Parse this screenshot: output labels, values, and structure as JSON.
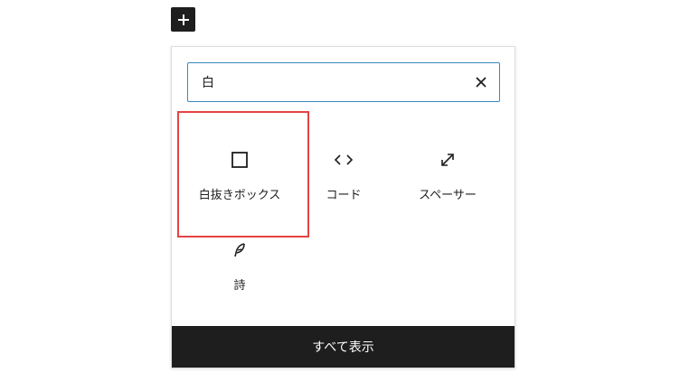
{
  "toolbar": {
    "add_block_icon": "plus-icon"
  },
  "search": {
    "value": "白",
    "clear_icon": "close-icon"
  },
  "blocks": [
    {
      "label": "白抜きボックス",
      "icon": "square-icon"
    },
    {
      "label": "コード",
      "icon": "code-icon"
    },
    {
      "label": "スペーサー",
      "icon": "resize-arrows-icon"
    },
    {
      "label": "詩",
      "icon": "quill-icon"
    }
  ],
  "footer": {
    "show_all_label": "すべて表示"
  },
  "colors": {
    "dark": "#1e1e1e",
    "focus_border": "#3a8ab9",
    "highlight": "#e54343"
  }
}
